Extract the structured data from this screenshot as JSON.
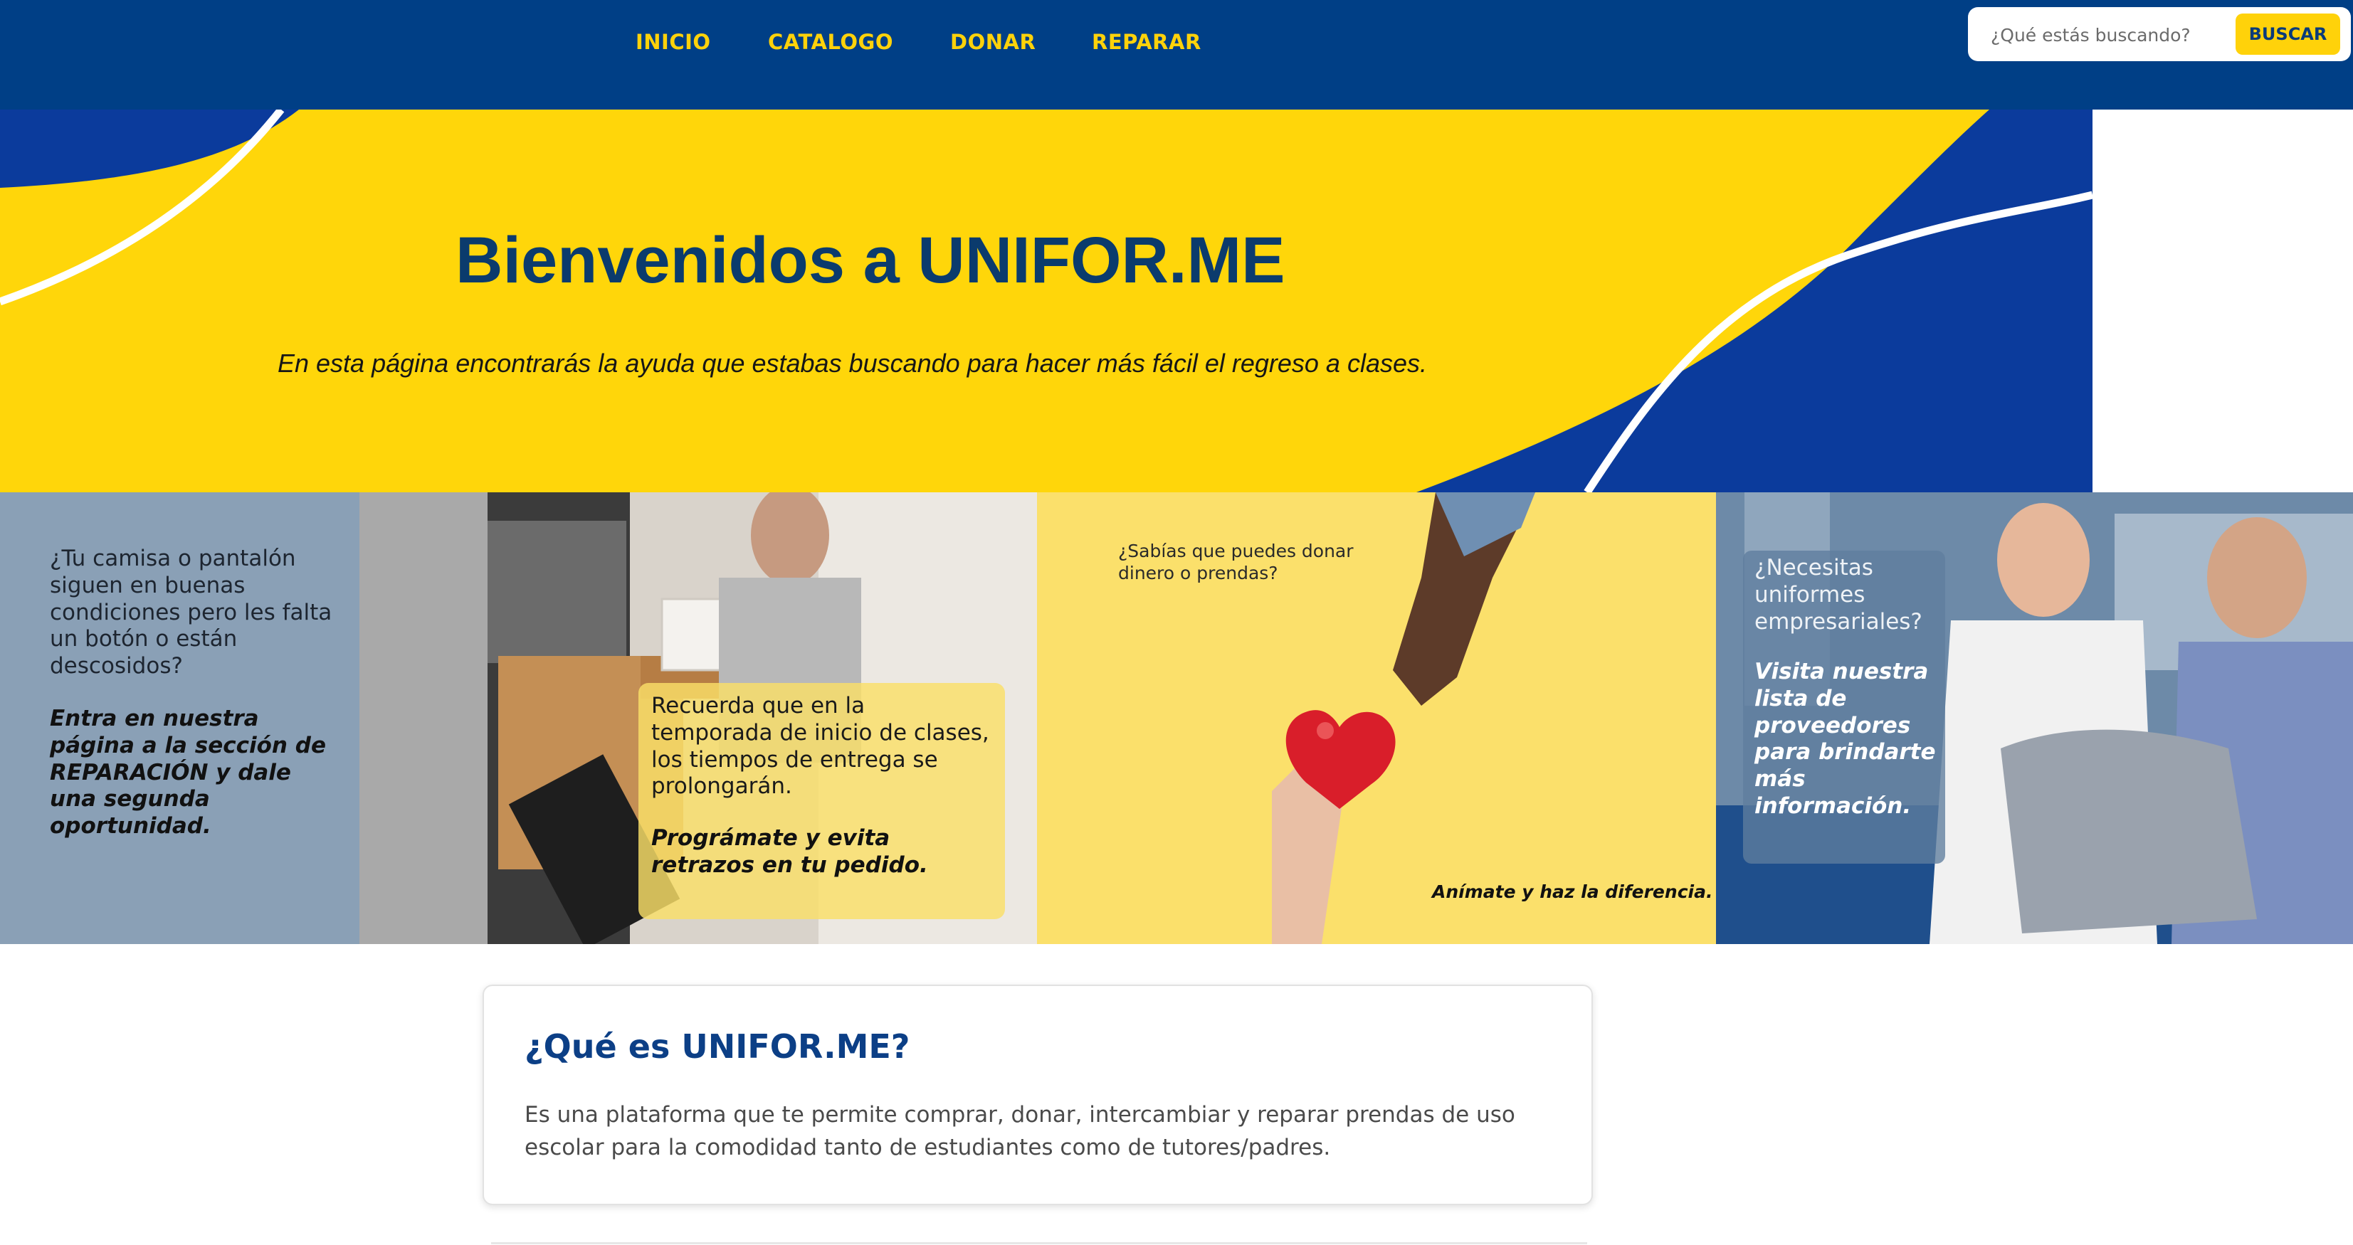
{
  "nav": {
    "items": [
      "INICIO",
      "CATALOGO",
      "DONAR",
      "REPARAR"
    ],
    "link_color": "#ffd20a",
    "background": "#003f86"
  },
  "search": {
    "placeholder": "¿Qué estás buscando?",
    "button_label": "BUSCAR",
    "button_color": "#ffd20a"
  },
  "hero": {
    "title": "Bienvenidos a UNIFOR.ME",
    "subtitle": "En esta página encontrarás la ayuda que estabas buscando para hacer más fácil el regreso a clases.",
    "colors": {
      "yellow": "#ffd60a",
      "blue": "#0b3b9c"
    }
  },
  "banner": {
    "repair": {
      "question": "¿Tu camisa o pantalón siguen en buenas condiciones pero les falta un botón o están descosidos?",
      "cta": "Entra en nuestra página a la sección de REPARACIÓN y dale una segunda oportunidad."
    },
    "delivery_notice": {
      "text": "Recuerda que en la temporada de inicio de clases, los tiempos de entrega se prolongarán.",
      "cta": "Prográmate y evita retrazos en tu pedido."
    },
    "donate": {
      "question": "¿Sabías que puedes donar dinero o prendas?",
      "cta": "Anímate y haz la diferencia."
    },
    "uniforms": {
      "question": "¿Necesitas uniformes empresariales?",
      "cta": "Visita nuestra lista de proveedores para brindarte más información."
    }
  },
  "about": {
    "title": "¿Qué es UNIFOR.ME?",
    "body": "Es una plataforma que te permite comprar, donar, intercambiar y reparar prendas de uso escolar para la comodidad tanto de estudiantes como de tutores/padres.",
    "title_color": "#0c3f86"
  }
}
